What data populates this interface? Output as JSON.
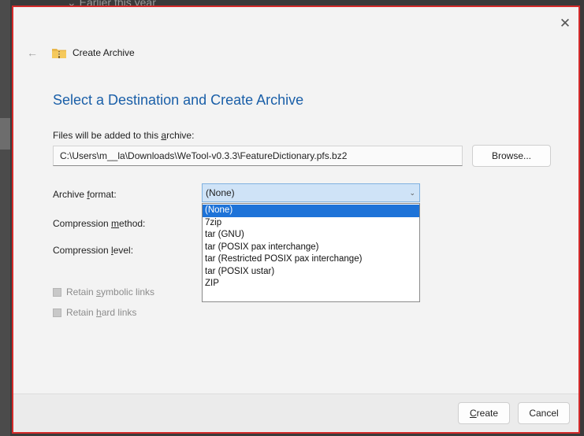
{
  "background": {
    "top_text": "Earlier this year"
  },
  "dialog": {
    "title": "Create Archive",
    "close_glyph": "✕",
    "back_glyph": "←",
    "heading": "Select a Destination and Create Archive",
    "files_label": "Files will be added to this archive:",
    "archive_path": "C:\\Users\\m__la\\Downloads\\WeTool-v0.3.3\\FeatureDictionary.pfs.bz2",
    "browse_button": "Browse...",
    "archive_format_label": "Archive format:",
    "archive_format_value": "(None)",
    "compression_method_label": "Compression method:",
    "compression_level_label": "Compression level:",
    "format_options": [
      "(None)",
      "7zip",
      "tar (GNU)",
      "tar (POSIX pax interchange)",
      "tar (Restricted POSIX pax interchange)",
      "tar (POSIX ustar)",
      "ZIP"
    ],
    "selected_option_index": 0,
    "retain_symbolic_links": "Retain symbolic links",
    "retain_hard_links": "Retain hard links",
    "create_button": "Create",
    "cancel_button": "Cancel"
  },
  "colors": {
    "highlight_border": "#d42a2a",
    "heading": "#1a5fa8",
    "selection": "#1e73d8"
  },
  "icons": {
    "title_icon": "folder-zip-icon",
    "close": "close-icon",
    "back": "back-arrow-icon",
    "dropdown": "chevron-down-icon"
  }
}
